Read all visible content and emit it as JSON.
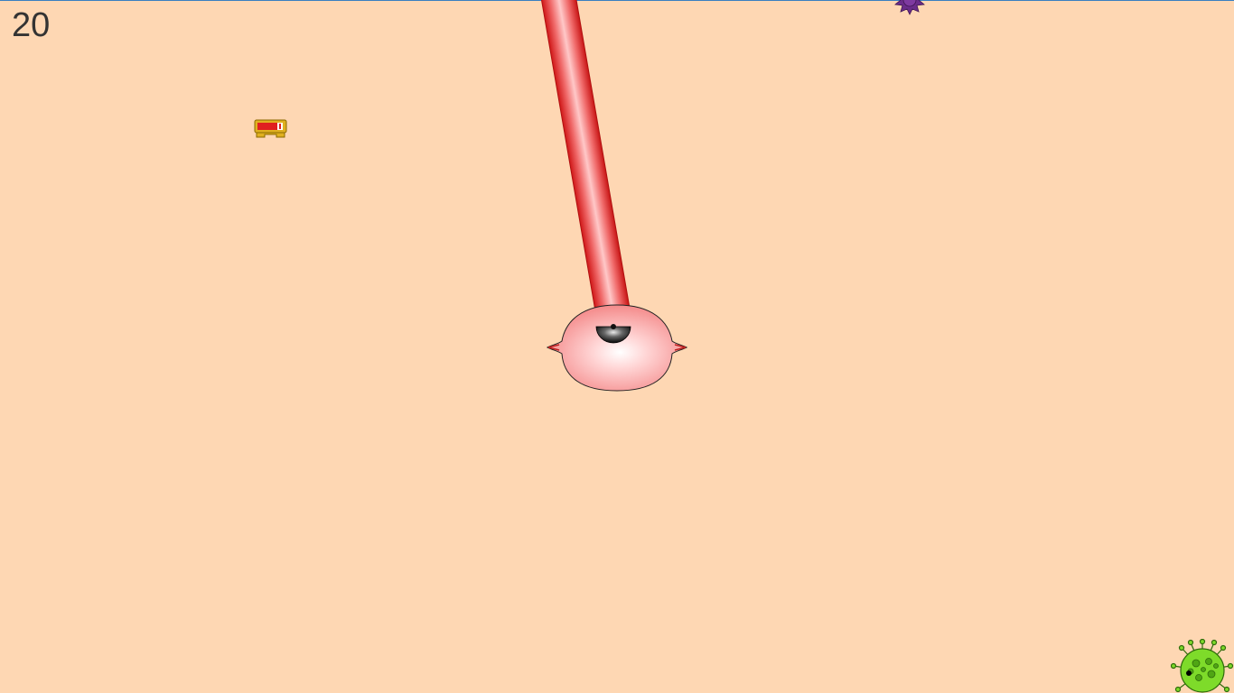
{
  "hud": {
    "score": "20"
  },
  "colors": {
    "background": "#FED7B3",
    "top_border": "#3A7FC0",
    "score_text": "#333333",
    "tube_red": "#E63A3A",
    "tube_highlight": "#FFD0D0",
    "cell_pink": "#F89090",
    "cell_center": "#FFFFFF",
    "nozzle_black": "#222222",
    "powerup_gold": "#D4A017",
    "powerup_red": "#E02020",
    "virus_green": "#6FD21E",
    "virus_purple": "#6A2C8A"
  },
  "entities": {
    "player_cell": {
      "icon": "white-blood-cell-icon"
    },
    "tentacle": {
      "icon": "tentacle-icon"
    },
    "nozzle": {
      "icon": "nozzle-icon"
    },
    "powerup": {
      "icon": "battery-powerup-icon"
    },
    "green_virus": {
      "icon": "green-virus-icon"
    },
    "purple_virus": {
      "icon": "purple-virus-icon"
    }
  }
}
